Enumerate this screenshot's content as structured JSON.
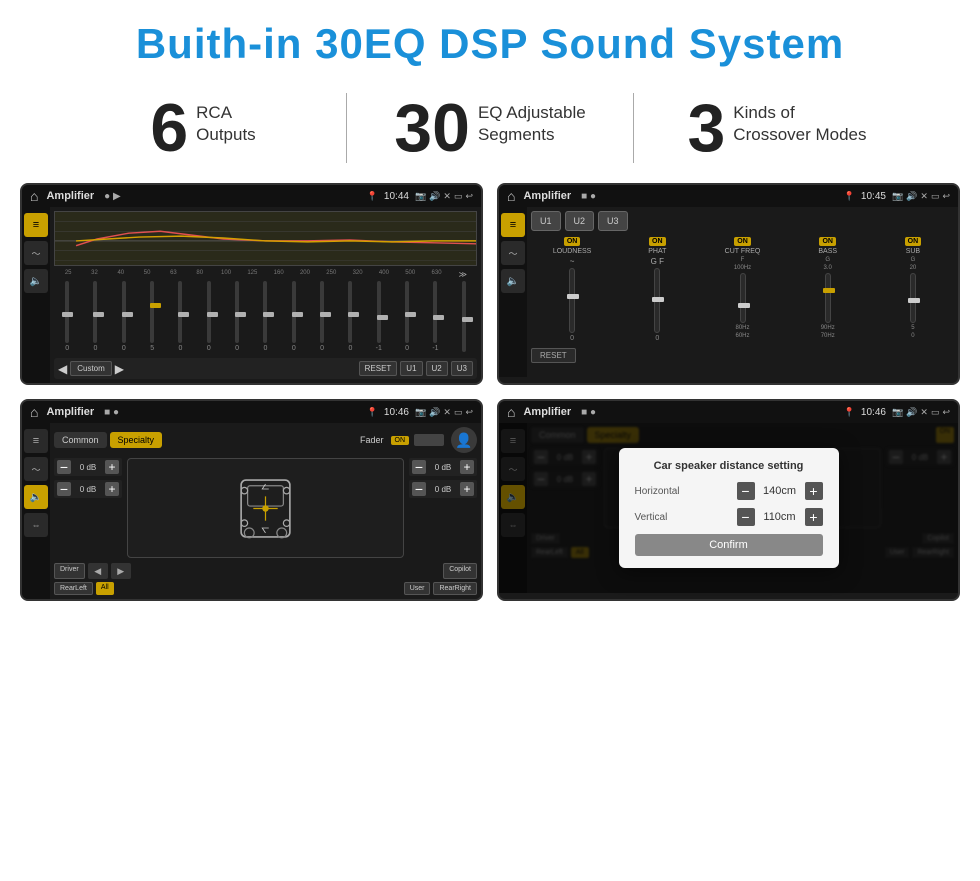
{
  "header": {
    "title": "Buith-in 30EQ DSP Sound System"
  },
  "stats": [
    {
      "number": "6",
      "line1": "RCA",
      "line2": "Outputs"
    },
    {
      "number": "30",
      "line1": "EQ Adjustable",
      "line2": "Segments"
    },
    {
      "number": "3",
      "line1": "Kinds of",
      "line2": "Crossover Modes"
    }
  ],
  "screens": {
    "screen1": {
      "app": "Amplifier",
      "time": "10:44",
      "freqs": [
        "25",
        "32",
        "40",
        "50",
        "63",
        "80",
        "100",
        "125",
        "160",
        "200",
        "250",
        "320",
        "400",
        "500",
        "630"
      ],
      "values": [
        "0",
        "0",
        "0",
        "5",
        "0",
        "0",
        "0",
        "0",
        "0",
        "0",
        "0",
        "-1",
        "0",
        "-1"
      ],
      "preset": "Custom",
      "buttons": [
        "RESET",
        "U1",
        "U2",
        "U3"
      ]
    },
    "screen2": {
      "app": "Amplifier",
      "time": "10:45",
      "presets": [
        "U1",
        "U2",
        "U3"
      ],
      "channels": [
        "LOUDNESS",
        "PHAT",
        "CUT FREQ",
        "BASS",
        "SUB"
      ],
      "resetLabel": "RESET"
    },
    "screen3": {
      "app": "Amplifier",
      "time": "10:46",
      "tabs": [
        "Common",
        "Specialty"
      ],
      "faderLabel": "Fader",
      "onLabel": "ON",
      "dbValues": [
        "0 dB",
        "0 dB",
        "0 dB",
        "0 dB"
      ],
      "buttons": [
        "Driver",
        "RearLeft",
        "All",
        "User",
        "Copilot",
        "RearRight"
      ]
    },
    "screen4": {
      "app": "Amplifier",
      "time": "10:46",
      "tabs": [
        "Common",
        "Specialty"
      ],
      "dialog": {
        "title": "Car speaker distance setting",
        "horizontal": {
          "label": "Horizontal",
          "value": "140cm"
        },
        "vertical": {
          "label": "Vertical",
          "value": "110cm"
        },
        "confirmLabel": "Confirm"
      },
      "dbValues": [
        "0 dB",
        "0 dB"
      ],
      "buttons": [
        "Driver",
        "RearLeft",
        "All",
        "User",
        "Copilot",
        "RearRight"
      ]
    }
  }
}
